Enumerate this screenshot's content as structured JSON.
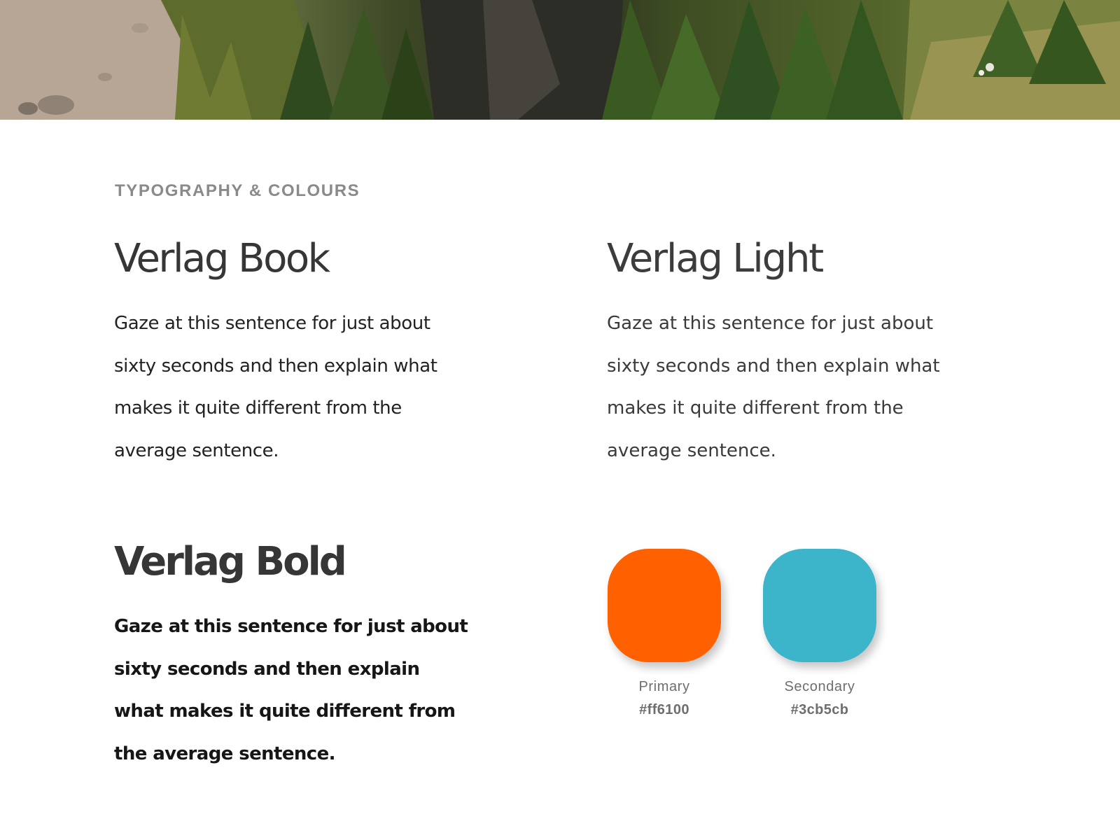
{
  "section": {
    "label": "TYPOGRAPHY & COLOURS"
  },
  "fonts": [
    {
      "name": "Verlag Book",
      "sample": "Gaze at this sentence for just about sixty seconds and then explain what makes it quite different from the average sentence."
    },
    {
      "name": "Verlag Light",
      "sample": "Gaze at this sentence for just about sixty seconds and then explain what makes it quite different from the average sentence."
    },
    {
      "name": "Verlag Bold",
      "sample": "Gaze at this sentence for just about sixty seconds and then explain what makes it quite different from the average sentence."
    }
  ],
  "colours": [
    {
      "name": "Primary",
      "hex": "#ff6100"
    },
    {
      "name": "Secondary",
      "hex": "#3cb5cb"
    }
  ]
}
